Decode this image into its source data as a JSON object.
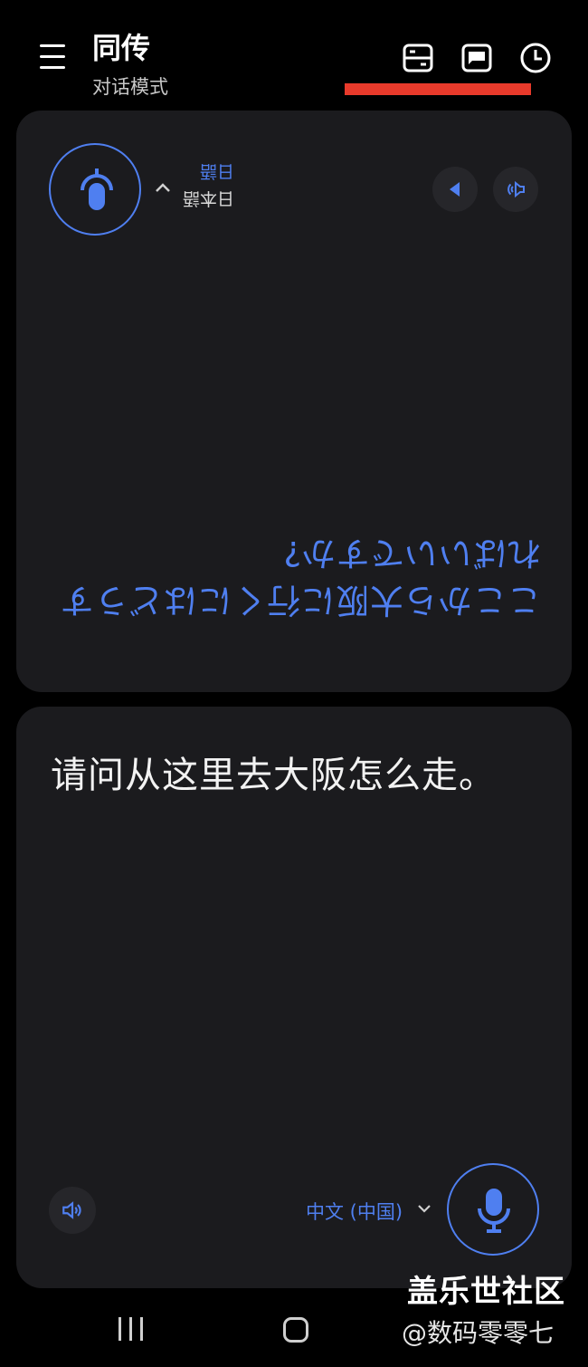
{
  "header": {
    "title": "同传",
    "subtitle": "对话模式",
    "icons": [
      "face-to-face-mode-icon",
      "subtitle-mode-icon",
      "history-icon"
    ],
    "highlight_color": "#e83a2b"
  },
  "top_panel": {
    "lang_name": "日本語",
    "lang_short": "日語",
    "translated_text": "ここから大阪に行くにはどうすればいいですか?",
    "text_color": "#4f7ff0",
    "orientation": "rotated 180°"
  },
  "bottom_panel": {
    "source_text": "请问从这里去大阪怎么走。",
    "language": "中文 (中国)"
  },
  "watermark": {
    "line1": "盖乐世社区",
    "line2": "@数码零零七"
  },
  "colors": {
    "accent": "#4f7ff0",
    "card_bg": "#1b1b1e",
    "page_bg": "#000000"
  }
}
